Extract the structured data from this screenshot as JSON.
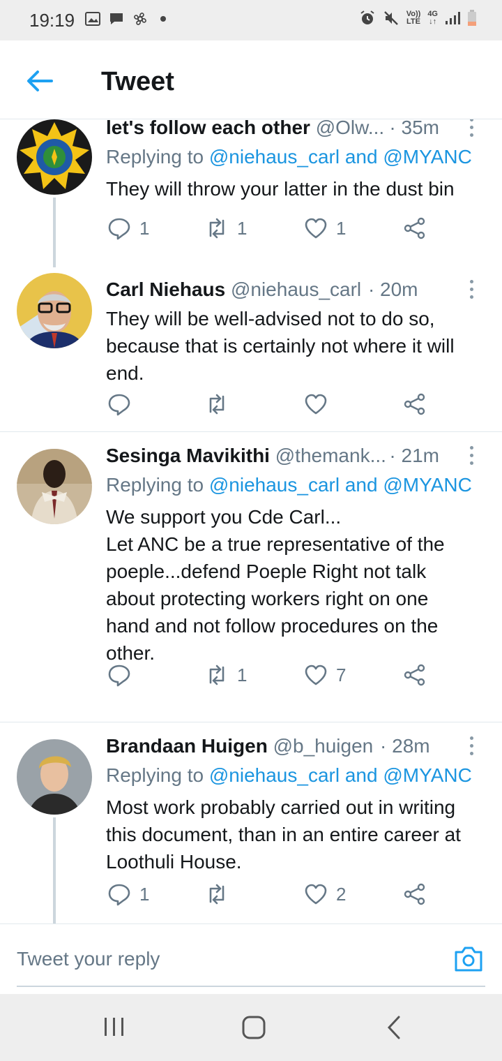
{
  "status_bar": {
    "time": "19:19",
    "left_icons": [
      "gallery-icon",
      "message-icon",
      "fan-icon",
      "dot-icon"
    ],
    "right_icons": [
      "alarm-icon",
      "mute-icon",
      "volte-icon",
      "4g-icon",
      "signal-icon",
      "battery-icon"
    ],
    "volte_label": "Vo))\nLTE",
    "network_label": "4G"
  },
  "header": {
    "title": "Tweet"
  },
  "tweets": [
    {
      "name": "let's follow each other",
      "handle": "@Olw...",
      "time": "· 35m",
      "replying_prefix": "Replying to ",
      "reply_to_1": "@niehaus_carl",
      "reply_and": " and ",
      "reply_to_2": "@MYANC",
      "text": "They will throw your latter in the dust bin",
      "replies": "1",
      "retweets": "1",
      "likes": "1",
      "avatar_color": "#1a1a1a"
    },
    {
      "name": "Carl Niehaus",
      "handle": "@niehaus_carl",
      "time": "· 20m",
      "text": "They will be well-advised not to do so,\nbecause that is certainly not where it will\nend.",
      "replies": "",
      "retweets": "",
      "likes": "",
      "avatar_color": "#e8c34a"
    },
    {
      "name": "Sesinga Mavikithi",
      "handle": "@themank...",
      "time": "· 21m",
      "replying_prefix": "Replying to ",
      "reply_to_1": "@niehaus_carl",
      "reply_and": " and ",
      "reply_to_2": "@MYANC",
      "text": "We support you Cde Carl...\nLet ANC be a true representative of the\npoeple...defend Poeple Right not talk\nabout protecting workers right on one\nhand and not follow procedures on the\nother.",
      "replies": "",
      "retweets": "1",
      "likes": "7",
      "avatar_color": "#c9b79a"
    },
    {
      "name": "Brandaan Huigen",
      "handle": "@b_huigen",
      "time": "· 28m",
      "replying_prefix": "Replying to ",
      "reply_to_1": "@niehaus_carl",
      "reply_and": " and ",
      "reply_to_2": "@MYANC",
      "text": "Most work probably carried out in writing\nthis document, than in an entire career at\nLoothuli House.",
      "replies": "1",
      "retweets": "",
      "likes": "2",
      "avatar_color": "#9aa2a8"
    }
  ],
  "reply_bar": {
    "placeholder": "Tweet your reply"
  },
  "colors": {
    "accent": "#1da1f2",
    "mention": "#1b95e0",
    "secondary_text": "#657786"
  }
}
